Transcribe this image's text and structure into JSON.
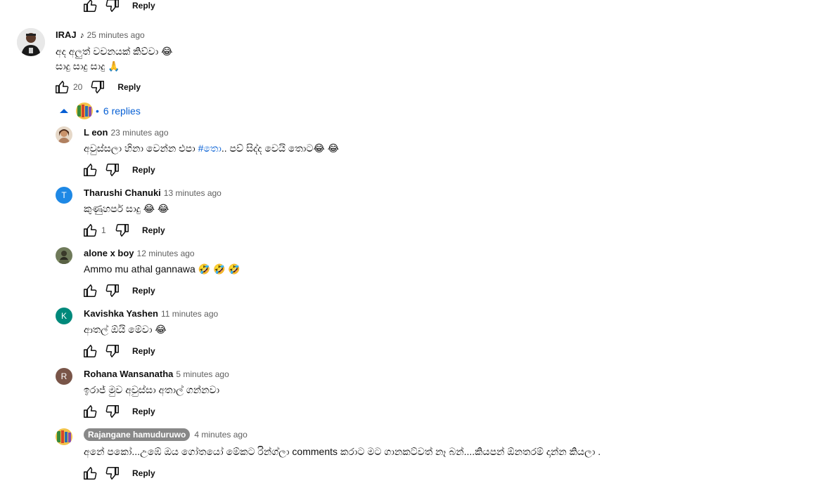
{
  "reply_label": "Reply",
  "top_partial": {},
  "main_comment": {
    "author": "IRAJ",
    "author_badge": "♪",
    "time": "25 minutes ago",
    "line1": "අද අලුත් වචනයක් කිව්වා 😂",
    "line2": "සාදු සාදු සාදු 🙏",
    "likes": "20"
  },
  "replies_toggle": {
    "label": "6 replies"
  },
  "replies": [
    {
      "author": "L eon",
      "time": "23 minutes ago",
      "text_before": "අවුස්සලා හිනා වෙන්න එපා ",
      "hashtag": "#තො",
      "text_after": ".. පව් සිද්ද වෙයි තොට😂 😂",
      "likes": "",
      "avatar": "photo"
    },
    {
      "author": "Tharushi Chanuki",
      "time": "13 minutes ago",
      "text": "කුණුහර්ප සාදු  😂 😂",
      "likes": "1",
      "avatar": "letter",
      "letter": "T",
      "color": "#1e88e5"
    },
    {
      "author": "alone x boy",
      "time": "12 minutes ago",
      "text": "Ammo mu athal gannawa 🤣 🤣 🤣",
      "likes": "",
      "avatar": "photo2"
    },
    {
      "author": "Kavishka Yashen",
      "time": "11 minutes ago",
      "text": "ආතල් ඕයි මේවා 😂",
      "likes": "",
      "avatar": "letter",
      "letter": "K",
      "color": "#00897b"
    },
    {
      "author": "Rohana Wansanatha",
      "time": "5 minutes ago",
      "text": "ඉරාජ් මුව අවුස්සා අතාල් ගන්නවා",
      "likes": "",
      "avatar": "letter",
      "letter": "R",
      "color": "#795548"
    },
    {
      "author": "Rajangane hamuduruwo",
      "time": "4 minutes ago",
      "text": "අනේ පකෝ...උඹේ ඔය ගෝතයෝ මේකට රින්ග්ලා comments කරාට මට ගානකට්වත් නෑ බන්....කියපන් ඕනතරම් දාන්න කියලා .",
      "likes": "",
      "avatar": "colorful",
      "highlighted": true
    }
  ],
  "colors": {
    "link": "#065fd4",
    "secondary": "#606060"
  }
}
